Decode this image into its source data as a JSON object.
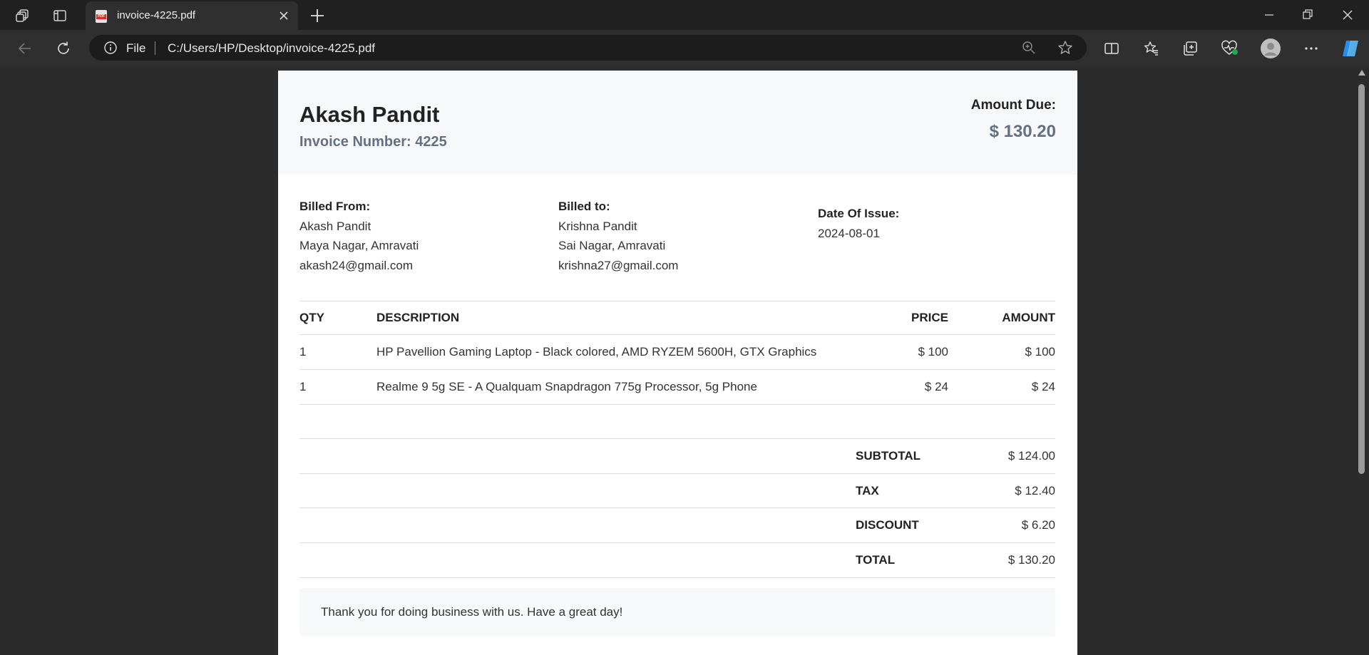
{
  "browser": {
    "tab_title": "invoice-4225.pdf",
    "pdf_badge": "PDF",
    "address_scheme": "File",
    "address_url": "C:/Users/HP/Desktop/invoice-4225.pdf"
  },
  "invoice": {
    "name": "Akash Pandit",
    "invoice_number": "Invoice Number: 4225",
    "amount_due_label": "Amount Due:",
    "amount_due_value": "$ 130.20",
    "billed_from": {
      "heading": "Billed From:",
      "name": "Akash Pandit",
      "address": "Maya Nagar, Amravati",
      "email": "akash24@gmail.com"
    },
    "billed_to": {
      "heading": "Billed to:",
      "name": "Krishna Pandit",
      "address": "Sai Nagar, Amravati",
      "email": "krishna27@gmail.com"
    },
    "date": {
      "heading": "Date Of Issue:",
      "value": "2024-08-01"
    },
    "columns": [
      "QTY",
      "DESCRIPTION",
      "PRICE",
      "AMOUNT"
    ],
    "items": [
      {
        "qty": "1",
        "description": "HP Pavellion Gaming Laptop - Black colored, AMD RYZEM 5600H, GTX Graphics",
        "price": "$ 100",
        "amount": "$ 100"
      },
      {
        "qty": "1",
        "description": "Realme 9 5g SE - A Qualquam Snapdragon 775g Processor, 5g Phone",
        "price": "$ 24",
        "amount": "$ 24"
      }
    ],
    "totals": [
      {
        "label": "SUBTOTAL",
        "value": "$ 124.00"
      },
      {
        "label": "TAX",
        "value": "$ 12.40"
      },
      {
        "label": "DISCOUNT",
        "value": "$ 6.20"
      },
      {
        "label": "TOTAL",
        "value": "$ 130.20"
      }
    ],
    "thanks": "Thank you for doing business with us. Have a great day!"
  },
  "icons": {
    "workspaces": "workspaces-icon",
    "tab_actions": "tab-actions-icon",
    "back": "back-arrow-icon",
    "refresh": "refresh-icon",
    "info": "info-icon",
    "zoom": "zoom-icon",
    "favorite": "star-icon",
    "split": "split-screen-icon",
    "favorites": "favorites-icon",
    "collections": "collections-icon",
    "health": "browser-essentials-icon",
    "profile": "profile-icon",
    "more": "more-icon",
    "copilot": "copilot-icon"
  },
  "colors": {
    "accent_text": "#667080",
    "header_bg": "#f7f8fa",
    "copilot": "#2a8cf0",
    "health_dot": "#1fa952"
  }
}
